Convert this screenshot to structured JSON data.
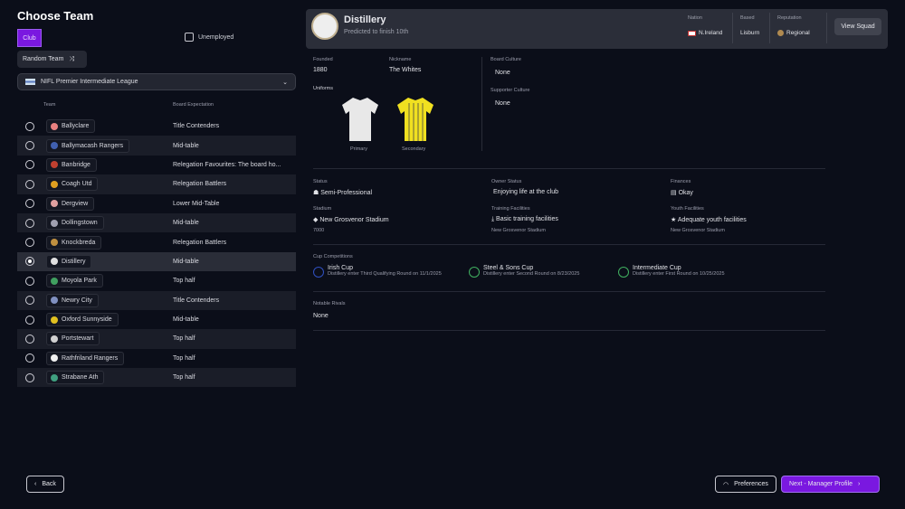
{
  "title": "Choose Team",
  "filters": {
    "club_label": "Club",
    "unemployed_label": "Unemployed",
    "random_label": "Random Team",
    "league": "NIFL Premier Intermediate League"
  },
  "table": {
    "headers": [
      "Team",
      "Board Expectation"
    ],
    "rows": [
      {
        "team": "Ballyclare",
        "expectation": "Title Contenders",
        "color": "#e88080"
      },
      {
        "team": "Ballymacash Rangers",
        "expectation": "Mid-table",
        "color": "#4060b0"
      },
      {
        "team": "Banbridge",
        "expectation": "Relegation Favourites: The board ho...",
        "color": "#c04030"
      },
      {
        "team": "Coagh Utd",
        "expectation": "Relegation Battlers",
        "color": "#e0a020"
      },
      {
        "team": "Dergview",
        "expectation": "Lower Mid-Table",
        "color": "#e0a0a0"
      },
      {
        "team": "Dollingstown",
        "expectation": "Mid-table",
        "color": "#a0a0b0"
      },
      {
        "team": "Knockbreda",
        "expectation": "Relegation Battlers",
        "color": "#c09040"
      },
      {
        "team": "Distillery",
        "expectation": "Mid-table",
        "color": "#e0e0e0",
        "selected": true
      },
      {
        "team": "Moyola Park",
        "expectation": "Top half",
        "color": "#40a060"
      },
      {
        "team": "Newry City",
        "expectation": "Title Contenders",
        "color": "#8090c0"
      },
      {
        "team": "Oxford Sunnyside",
        "expectation": "Mid-table",
        "color": "#e0c020"
      },
      {
        "team": "Portstewart",
        "expectation": "Top half",
        "color": "#d0d0d0"
      },
      {
        "team": "Rathfriland Rangers",
        "expectation": "Top half",
        "color": "#f0f0f0"
      },
      {
        "team": "Strabane Ath",
        "expectation": "Top half",
        "color": "#40a080"
      }
    ]
  },
  "club": {
    "name": "Distillery",
    "prediction": "Predicted to finish 10th",
    "nation_label": "Nation",
    "nation": "N.Ireland",
    "based_label": "Based",
    "based": "Lisburn",
    "reputation_label": "Reputation",
    "reputation": "Regional",
    "view_squad": "View Squad",
    "founded_label": "Founded",
    "founded": "1880",
    "nickname_label": "Nickname",
    "nickname": "The Whites",
    "uniforms_label": "Uniforms",
    "primary": "Primary",
    "secondary": "Secondary",
    "board_culture_label": "Board Culture",
    "board_culture": "None",
    "supporter_culture_label": "Supporter Culture",
    "supporter_culture": "None",
    "status_label": "Status",
    "status": "Semi-Professional",
    "owner_status_label": "Owner Status",
    "owner_status": "Enjoying life at the club",
    "finances_label": "Finances",
    "finances": "Okay",
    "stadium_label": "Stadium",
    "stadium": "New Grosvenor Stadium",
    "capacity": "7000",
    "training_label": "Training Facilities",
    "training": "Basic training facilities",
    "training_loc": "New Grosvenor Stadium",
    "youth_label": "Youth Facilities",
    "youth": "Adequate youth facilities",
    "youth_loc": "New Grosvenor Stadium",
    "cups_label": "Cup Competitions",
    "cups": [
      {
        "name": "Irish Cup",
        "detail": "Distillery enter Third Qualifying Round on 11/1/2025",
        "color": "#3050c0"
      },
      {
        "name": "Steel & Sons Cup",
        "detail": "Distillery enter Second Round on 8/23/2025",
        "color": "#40b060"
      },
      {
        "name": "Intermediate Cup",
        "detail": "Distillery enter First Round on 10/25/2025",
        "color": "#40b060"
      }
    ],
    "rivals_label": "Notable Rivals",
    "rivals": "None"
  },
  "footer": {
    "back": "Back",
    "preferences": "Preferences",
    "next": "Next - Manager Profile"
  }
}
